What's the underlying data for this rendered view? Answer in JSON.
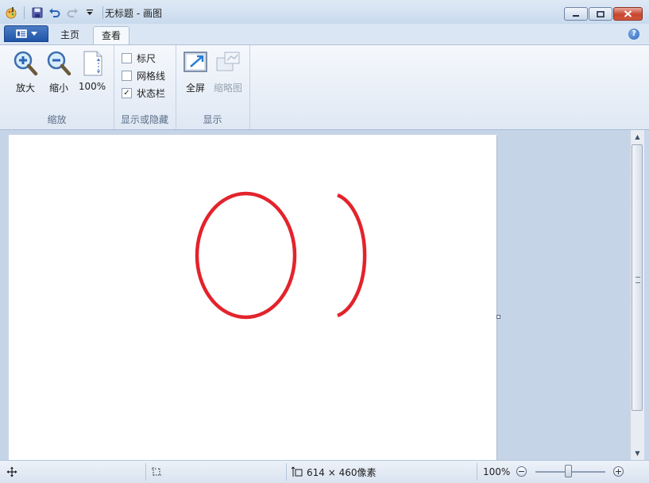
{
  "window": {
    "title": "无标题 - 画图"
  },
  "tabs": {
    "home": "主页",
    "view": "查看"
  },
  "ribbon": {
    "zoom_group": {
      "label": "缩放",
      "zoom_in": "放大",
      "zoom_out": "缩小",
      "zoom_100": "100%"
    },
    "show_hide_group": {
      "label": "显示或隐藏",
      "ruler": {
        "label": "标尺",
        "checked": false
      },
      "gridlines": {
        "label": "网格线",
        "checked": false
      },
      "statusbar": {
        "label": "状态栏",
        "checked": true,
        "mark": "✓"
      }
    },
    "display_group": {
      "label": "显示",
      "fullscreen": "全屏",
      "thumbnail": "缩略图"
    }
  },
  "canvas": {
    "stroke_color": "#e3232c"
  },
  "statusbar": {
    "image_size": "614 × 460像素",
    "zoom_level": "100%"
  },
  "colors": {
    "accent": "#1f55a8",
    "close_button": "#c7452d"
  }
}
